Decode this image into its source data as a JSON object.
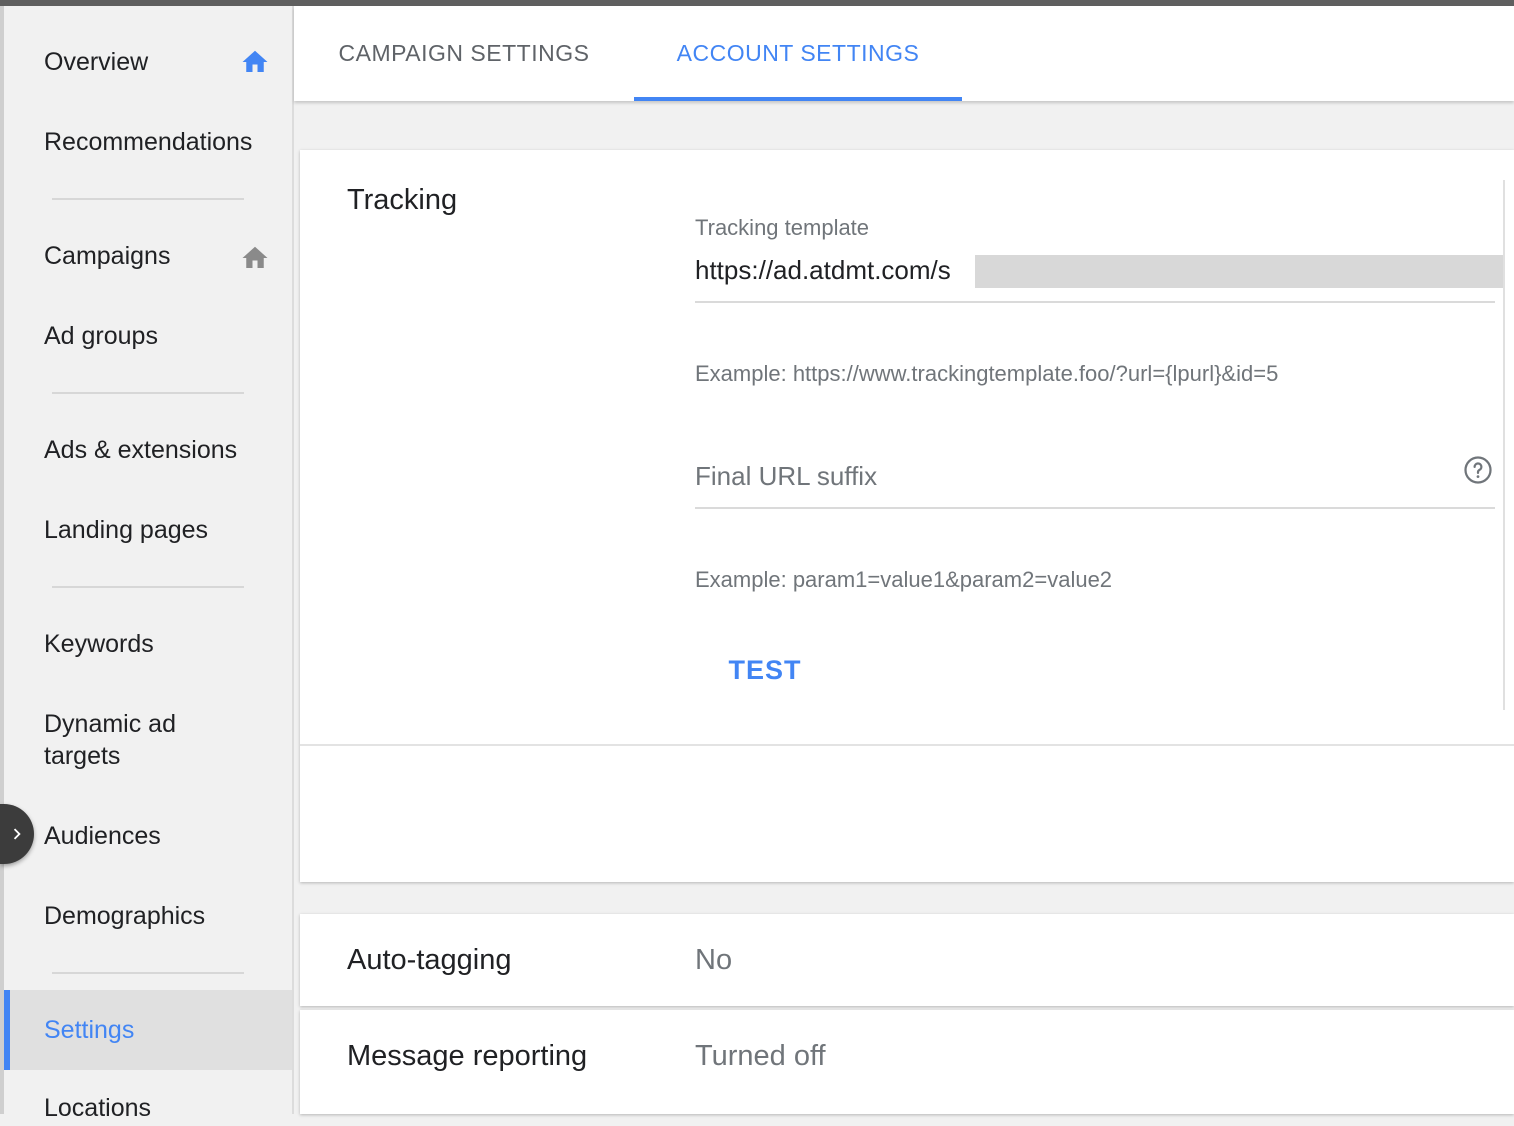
{
  "sidebar": {
    "items": [
      {
        "label": "Overview",
        "icon": "home-icon",
        "icon_color": "#4285f4"
      },
      {
        "label": "Recommendations"
      },
      {
        "label": "Campaigns",
        "icon": "home-icon",
        "icon_color": "#8a8a8a"
      },
      {
        "label": "Ad groups"
      },
      {
        "label": "Ads & extensions"
      },
      {
        "label": "Landing pages"
      },
      {
        "label": "Keywords"
      },
      {
        "label": "Dynamic ad targets"
      },
      {
        "label": "Audiences"
      },
      {
        "label": "Demographics"
      },
      {
        "label": "Settings",
        "active": true
      },
      {
        "label": "Locations"
      }
    ],
    "toggle_icon": "chevron-right-icon"
  },
  "tabs": [
    {
      "label": "CAMPAIGN SETTINGS",
      "active": false
    },
    {
      "label": "ACCOUNT SETTINGS",
      "active": true
    }
  ],
  "tracking": {
    "title": "Tracking",
    "template_label": "Tracking template",
    "template_value": "https://ad.atdmt.com/s",
    "template_example": "Example: https://www.trackingtemplate.foo/?url={lpurl}&id=5",
    "suffix_placeholder": "Final URL suffix",
    "suffix_example": "Example: param1=value1&param2=value2",
    "test_label": "TEST",
    "help_icon": "help-circle-icon"
  },
  "settings_rows": [
    {
      "label": "Auto-tagging",
      "value": "No"
    },
    {
      "label": "Message reporting",
      "value": "Turned off"
    }
  ],
  "colors": {
    "accent": "#4285f4",
    "text": "#202124",
    "secondary_text": "#70757a"
  }
}
